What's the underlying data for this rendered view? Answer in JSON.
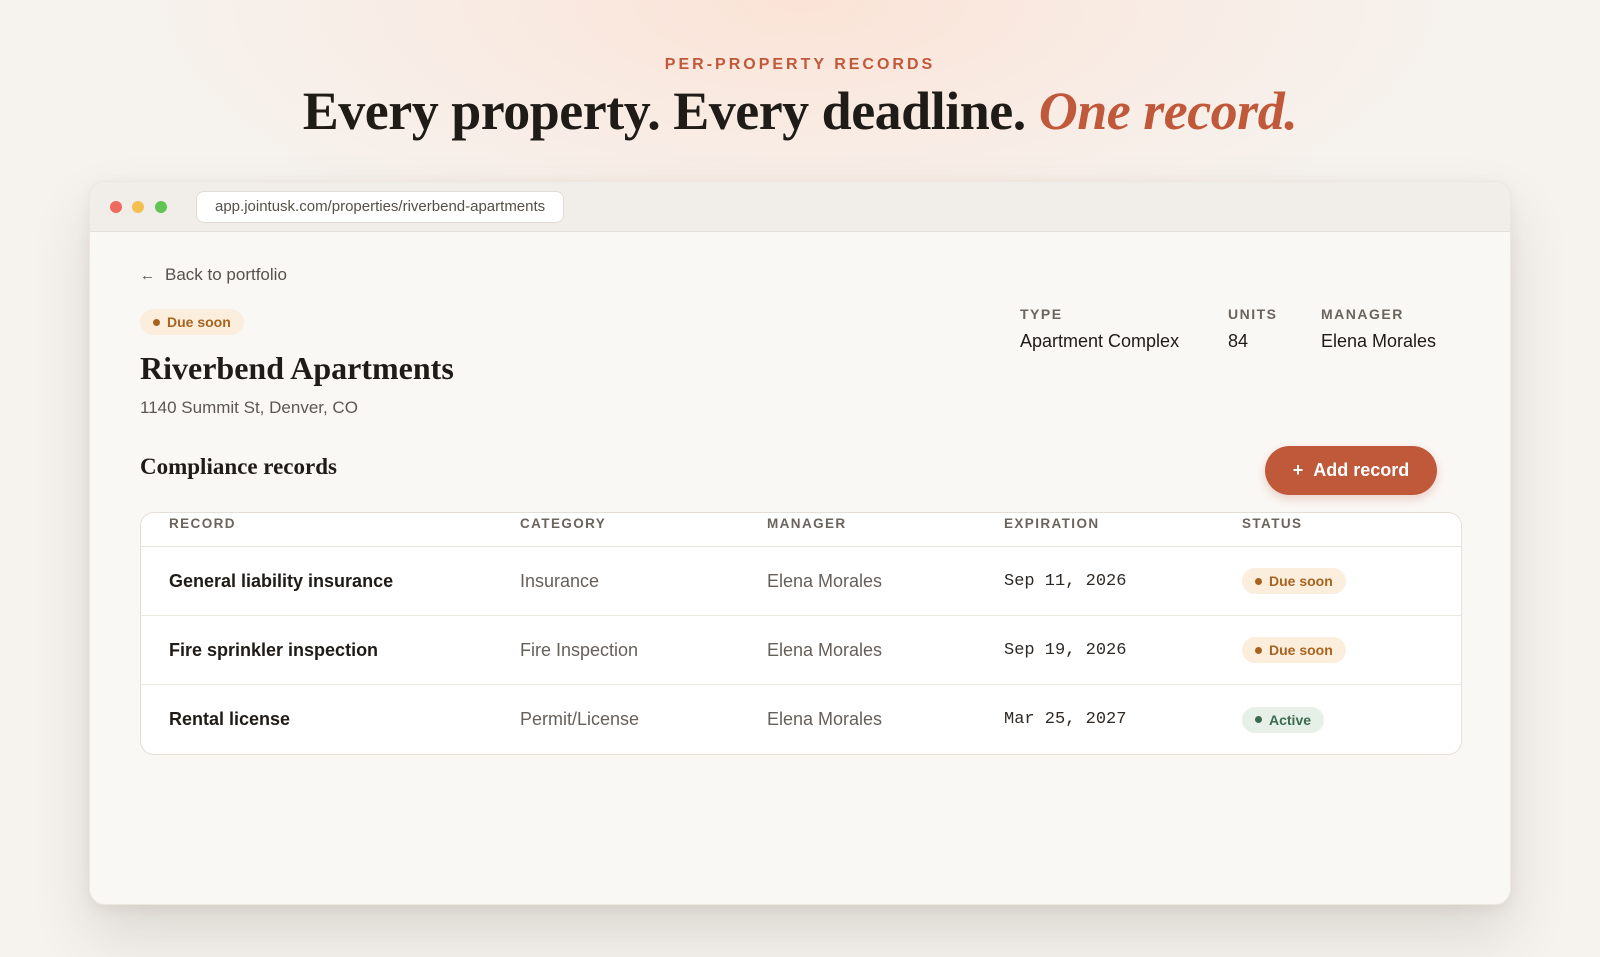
{
  "hero": {
    "eyebrow": "PER-PROPERTY RECORDS",
    "headline_main": "Every property. Every deadline.",
    "headline_accent": "One record."
  },
  "browser": {
    "url": "app.jointusk.com/properties/riverbend-apartments"
  },
  "property": {
    "back_label": "Back to portfolio",
    "status": "Due soon",
    "name": "Riverbend Apartments",
    "address": "1140 Summit St, Denver, CO",
    "meta": [
      {
        "label": "TYPE",
        "value": "Apartment Complex"
      },
      {
        "label": "UNITS",
        "value": "84"
      },
      {
        "label": "MANAGER",
        "value": "Elena Morales"
      }
    ]
  },
  "records": {
    "section_title": "Compliance records",
    "add_label": "Add record",
    "columns": [
      "RECORD",
      "CATEGORY",
      "MANAGER",
      "EXPIRATION",
      "STATUS"
    ],
    "rows": [
      {
        "record": "General liability insurance",
        "category": "Insurance",
        "manager": "Elena Morales",
        "expiration": "Sep 11, 2026",
        "status": "Due soon",
        "status_type": "due"
      },
      {
        "record": "Fire sprinkler inspection",
        "category": "Fire Inspection",
        "manager": "Elena Morales",
        "expiration": "Sep 19, 2026",
        "status": "Due soon",
        "status_type": "due"
      },
      {
        "record": "Rental license",
        "category": "Permit/License",
        "manager": "Elena Morales",
        "expiration": "Mar 25, 2027",
        "status": "Active",
        "status_type": "active"
      }
    ]
  },
  "colors": {
    "accent": "#c0583a",
    "due": "#a8641f",
    "active": "#3c6b4f"
  }
}
